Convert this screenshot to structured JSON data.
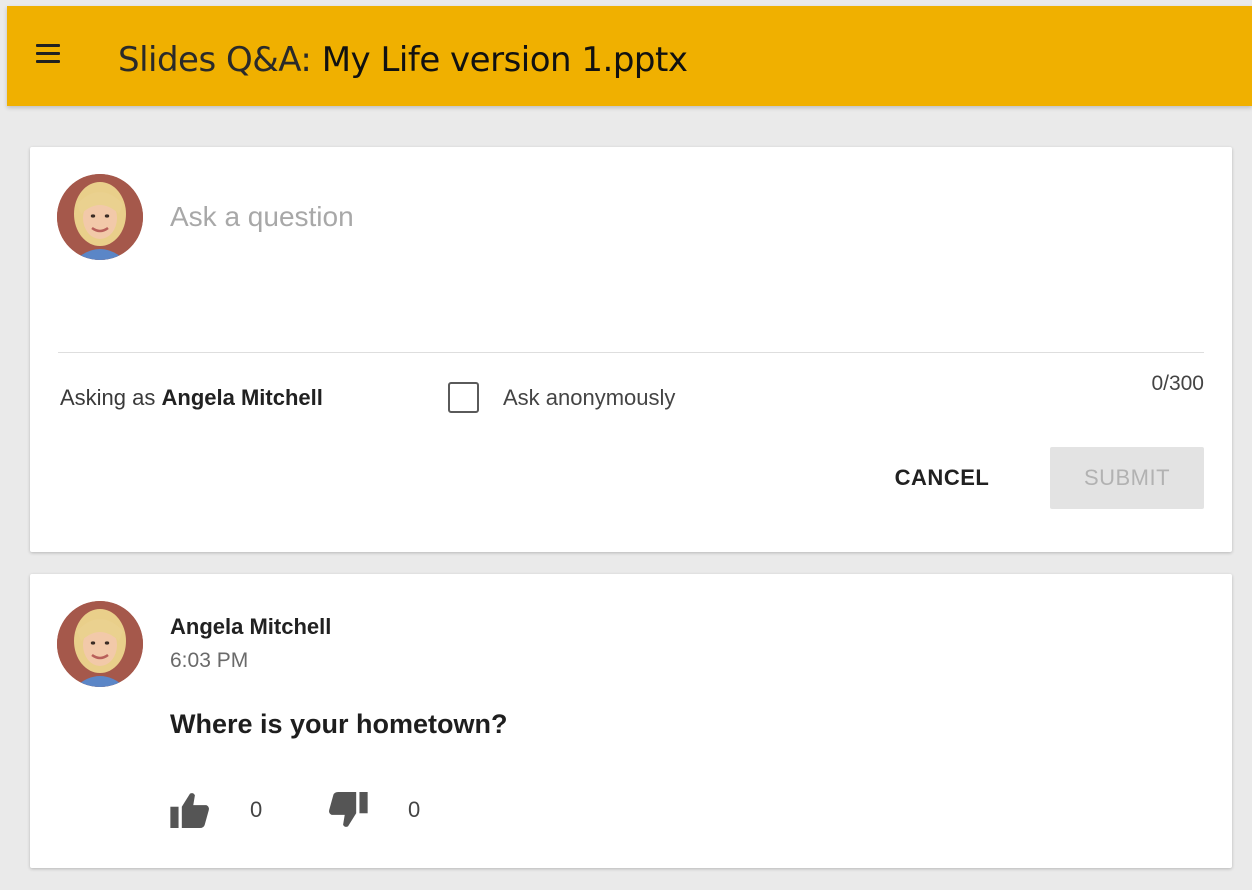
{
  "header": {
    "title_prefix": "Slides Q&A: ",
    "title_file": "My Life version 1.pptx",
    "bg_color": "#f0b000"
  },
  "compose": {
    "placeholder": "Ask a question",
    "asking_as_prefix": "Asking as ",
    "asking_as_name": "Angela Mitchell",
    "anonymous_label": "Ask anonymously",
    "anonymous_checked": false,
    "char_counter": "0/300",
    "cancel_label": "CANCEL",
    "submit_label": "SUBMIT",
    "submit_enabled": false
  },
  "questions": [
    {
      "author": "Angela Mitchell",
      "time": "6:03 PM",
      "text": "Where is your hometown?",
      "upvotes": "0",
      "downvotes": "0"
    }
  ],
  "icons": {
    "menu": "menu-icon",
    "avatar": "avatar-photo",
    "upvote": "thumb-up-icon",
    "downvote": "thumb-down-icon"
  }
}
